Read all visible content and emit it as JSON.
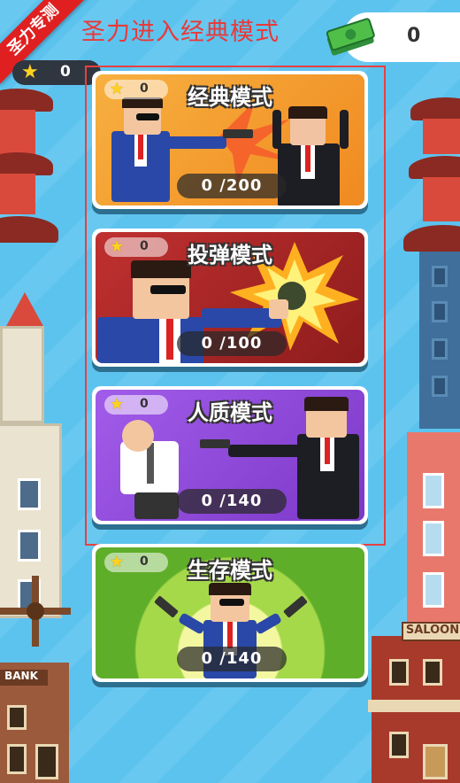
{
  "header": {
    "title": "圣力进入经典模式",
    "ribbon_label": "圣力专测",
    "star_count": "0",
    "money_count": "0"
  },
  "modes": [
    {
      "title": "经典模式",
      "stars": "0",
      "progress": "0 /200",
      "theme": "#f29a30"
    },
    {
      "title": "投弹模式",
      "stars": "0",
      "progress": "0 /100",
      "theme": "#b32a2a"
    },
    {
      "title": "人质模式",
      "stars": "0",
      "progress": "0 /140",
      "theme": "#9a4fe0"
    },
    {
      "title": "生存模式",
      "stars": "0",
      "progress": "0 /140",
      "theme": "#6fc232"
    }
  ],
  "scenery": {
    "bank_sign": "BANK",
    "saloon_sign": "SALOON"
  },
  "colors": {
    "sky": "#5cc3ef",
    "title_red": "#e83a3a",
    "ribbon_red": "#e02020",
    "frame_red": "#e84040"
  }
}
